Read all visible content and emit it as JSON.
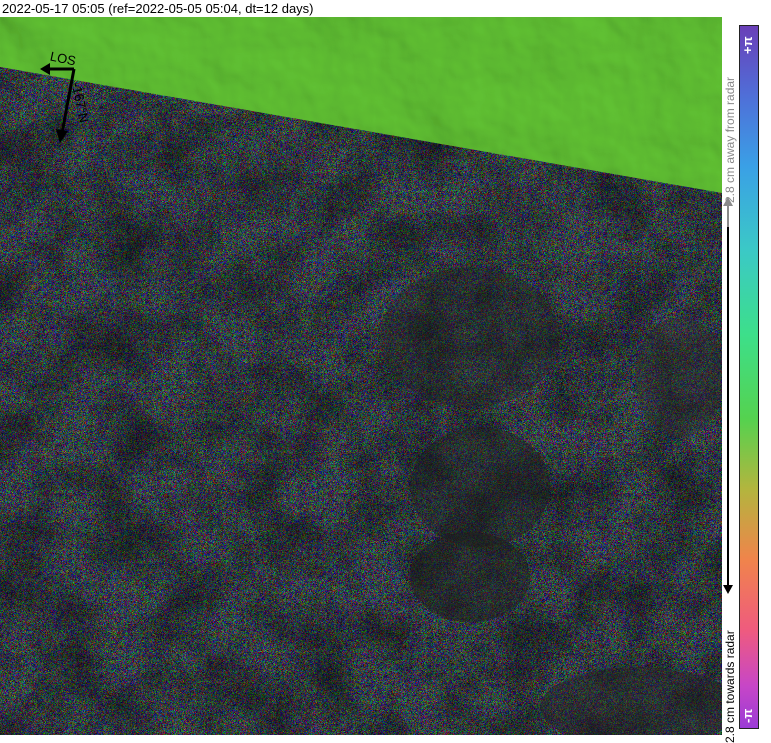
{
  "title": "2022-05-17 05:05 (ref=2022-05-05 05:04, dt=12 days)",
  "compass": {
    "los_label": "LOS",
    "heading_label": "-167°N"
  },
  "colorbar": {
    "top_label": "+π",
    "bottom_label": "-π",
    "away_label": "2.8 cm away from radar",
    "toward_label": "2.8 cm towards radar",
    "colors": [
      "#6a3fb8",
      "#3aa0e6",
      "#3ddf8a",
      "#55d24f",
      "#f0844b",
      "#ef5b7e",
      "#9b3bd6"
    ]
  },
  "map": {
    "background_color": "#6fd23f",
    "noise_colors": [
      "#e05a4e",
      "#3fb3e0",
      "#4ad86a",
      "#b04fd1",
      "#e0b43f",
      "#3fd1c4",
      "#e67aa8",
      "#6f7f3a",
      "#5a5a7a",
      "#8fe04a"
    ]
  }
}
